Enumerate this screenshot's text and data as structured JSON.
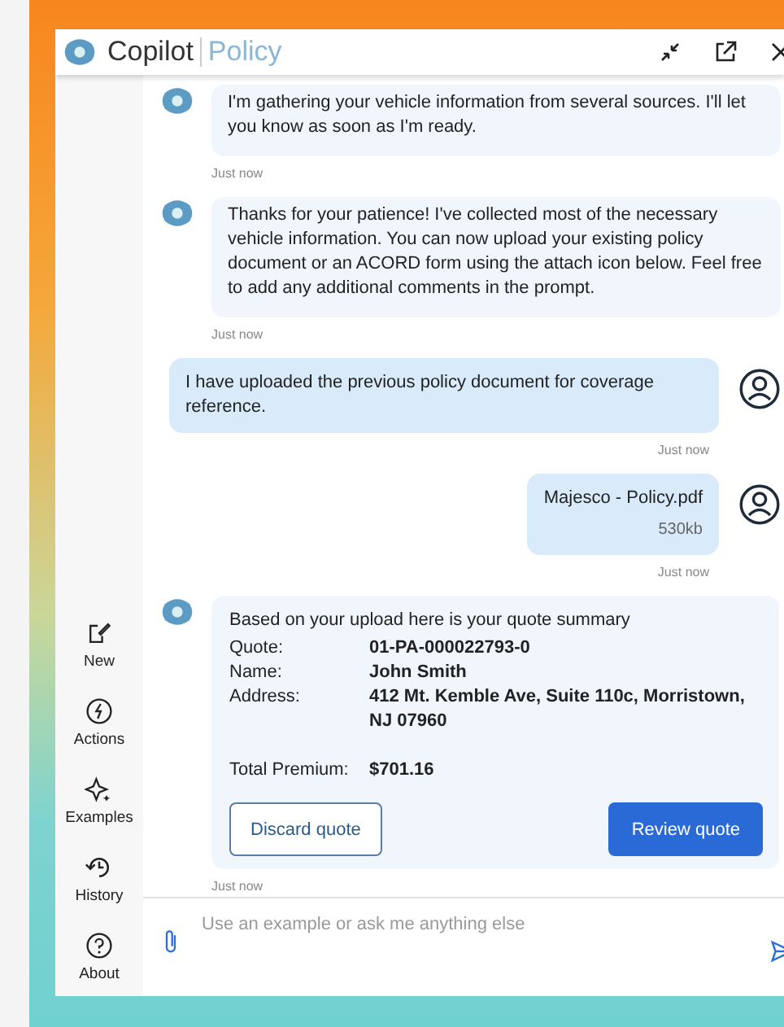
{
  "header": {
    "brand": "Copilot",
    "product": "Policy"
  },
  "sidebar": {
    "items": [
      {
        "label": "New"
      },
      {
        "label": "Actions"
      },
      {
        "label": "Examples"
      },
      {
        "label": "History"
      },
      {
        "label": "About"
      }
    ]
  },
  "messages": [
    {
      "kind": "bot",
      "text": "I'm gathering your vehicle information from several sources. I'll let you know as soon as I'm ready.",
      "timestamp": "Just now"
    },
    {
      "kind": "bot",
      "text": "Thanks for your patience! I've collected most of the necessary vehicle information. You can now upload your existing policy document or an ACORD form using the attach icon below. Feel free to add any additional comments in the prompt.",
      "timestamp": "Just now"
    },
    {
      "kind": "user",
      "text": "I have uploaded the previous policy document for coverage reference.",
      "timestamp": "Just now"
    },
    {
      "kind": "file",
      "text": "Majesco - Policy.pdf",
      "size": "530kb",
      "timestamp": "Just now"
    },
    {
      "kind": "quote",
      "text": "Based on your upload here is your quote summary",
      "fields": [
        {
          "label": "Quote:",
          "value": "01-PA-000022793-0"
        },
        {
          "label": "Name:",
          "value": "John Smith"
        },
        {
          "label": "Address:",
          "value": "412 Mt. Kemble Ave, Suite 110c, Morristown, NJ 07960"
        }
      ],
      "total": {
        "label": "Total Premium:",
        "value": "$701.16"
      },
      "buttons": [
        {
          "label": "Discard quote",
          "kind": "secondary"
        },
        {
          "label": "Review quote",
          "kind": "primary"
        }
      ],
      "timestamp": "Just now"
    }
  ],
  "input": {
    "placeholder": "Use an example or ask me anything else"
  }
}
